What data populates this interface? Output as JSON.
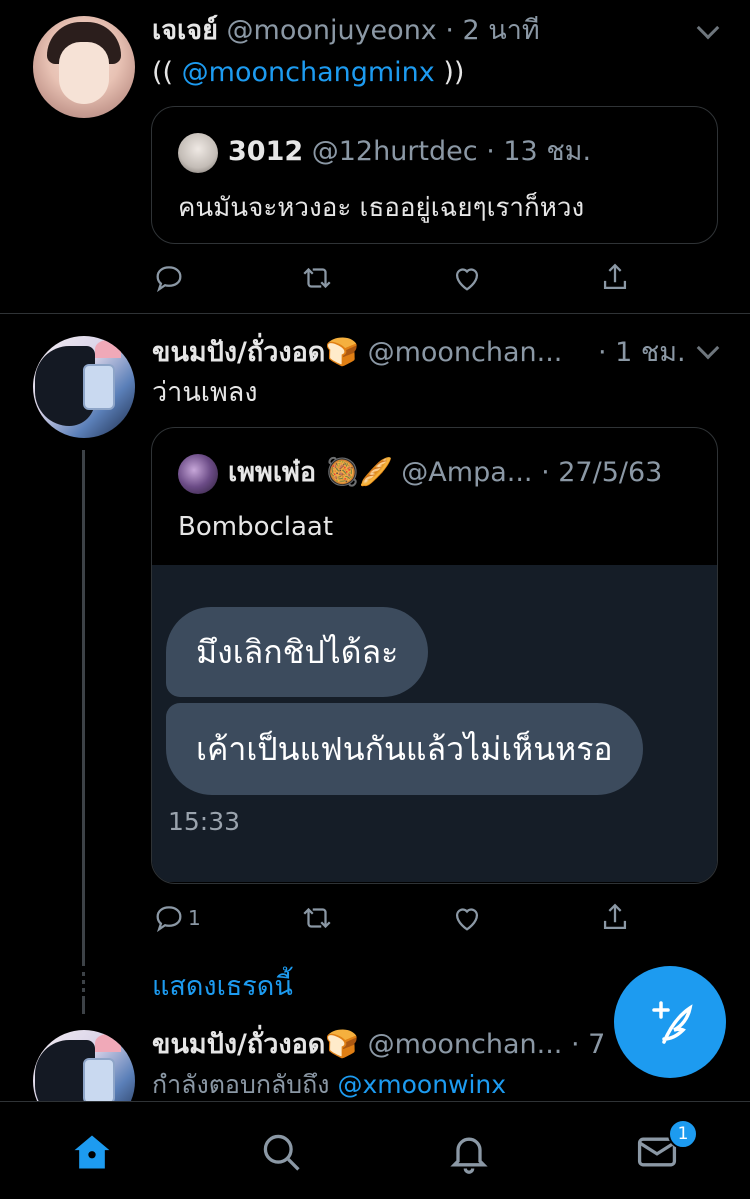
{
  "tweets": [
    {
      "name": "เจเจย์",
      "handle": "@moonjuyeonx",
      "time": "· 2 นาที",
      "text_prefix": "((",
      "mention": "@moonchangminx",
      "text_suffix": "))",
      "quote": {
        "name": "3012",
        "handle": "@12hurtdec",
        "time": "· 13 ชม.",
        "text": "คนมันจะหวงอะ เธออยู่เฉยๆเราก็หวง"
      }
    },
    {
      "name": "ขนมปัง/ถั่วงอด🍞",
      "handle": "@moonchan...",
      "time": "· 1 ชม.",
      "text": "ว่านเพลง",
      "quote": {
        "name": "เพพเพ๋อ 🥘🥖",
        "handle": "@Ampa...",
        "time": "· 27/5/63",
        "text": "Bomboclaat",
        "chat_bubbles": [
          "มึงเลิกชิปได้ละ",
          "เค้าเป็นแฟนกันแล้วไม่เห็นหรอ"
        ],
        "chat_time": "15:33"
      },
      "reply_count": "1"
    },
    {
      "name": "ขนมปัง/ถั่วงอด🍞",
      "handle": "@moonchan...",
      "time": "· 7",
      "reply_prefix": "กำลังตอบกลับถึง",
      "reply_mention": "@xmoonwinx"
    }
  ],
  "show_thread": "แสดงเธรดนี้",
  "tabbar": {
    "icons": [
      "home-icon",
      "search-icon",
      "bell-icon",
      "mail-icon"
    ],
    "badge": "1"
  },
  "colors": {
    "accent": "#1d9bf0",
    "background": "#000000",
    "secondary_text": "#8b98a5"
  }
}
